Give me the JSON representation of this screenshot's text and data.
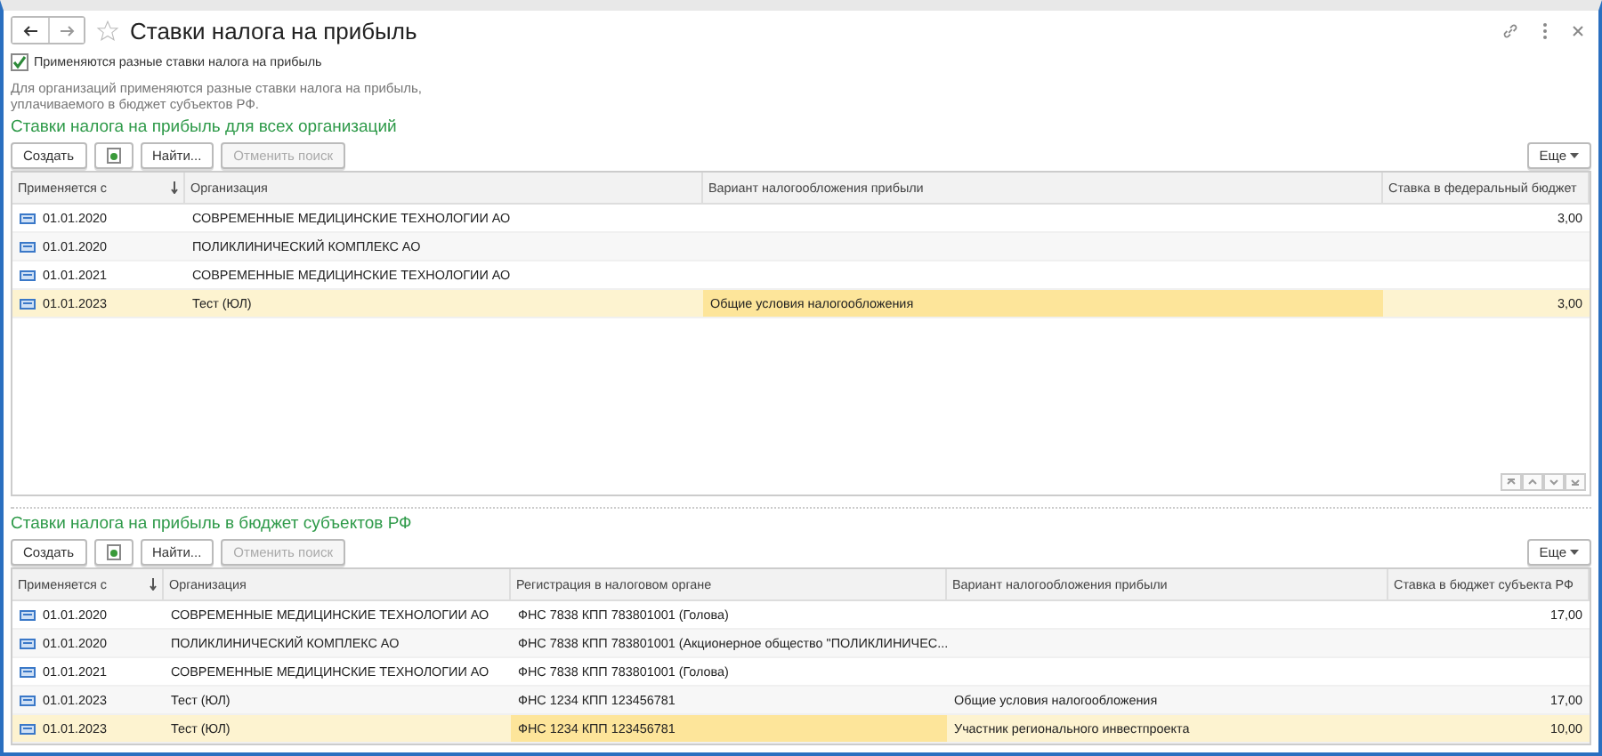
{
  "window": {
    "title": "Ставки налога на прибыль"
  },
  "option": {
    "label": "Применяются разные ставки налога на прибыль",
    "checked": true
  },
  "note": "Для организаций применяются разные ставки налога на прибыль,\nуплачиваемого в бюджет субъектов РФ.",
  "sections": [
    {
      "title": "Ставки налога на прибыль для всех организаций",
      "toolbar": {
        "create": "Создать",
        "find": "Найти...",
        "cancel": {
          "label": "Отменить поиск",
          "disabled": true
        },
        "more": "Еще"
      },
      "columns": [
        {
          "label": "Применяется с",
          "sorted": true,
          "current": false
        },
        {
          "label": "Организация",
          "sorted": false,
          "current": false
        },
        {
          "label": "Вариант налогообложения прибыли",
          "sorted": false,
          "current": true
        },
        {
          "label": "Ставка в федеральный бюджет",
          "sorted": false,
          "current": false
        }
      ],
      "rows": [
        {
          "cells": [
            "01.01.2020",
            "СОВРЕМЕННЫЕ МЕДИЦИНСКИЕ ТЕХНОЛОГИИ АО",
            "",
            "3,00"
          ],
          "selected": false
        },
        {
          "cells": [
            "01.01.2020",
            "ПОЛИКЛИНИЧЕСКИЙ КОМПЛЕКС АО",
            "",
            ""
          ],
          "selected": false
        },
        {
          "cells": [
            "01.01.2021",
            "СОВРЕМЕННЫЕ МЕДИЦИНСКИЕ ТЕХНОЛОГИИ АО",
            "",
            ""
          ],
          "selected": false
        },
        {
          "cells": [
            "01.01.2023",
            "Тест (ЮЛ)",
            "Общие условия налогообложения",
            "3,00"
          ],
          "selected": true
        }
      ],
      "pager": true
    },
    {
      "title": "Ставки налога на прибыль в бюджет субъектов РФ",
      "toolbar": {
        "create": "Создать",
        "find": "Найти...",
        "cancel": {
          "label": "Отменить поиск",
          "disabled": true
        },
        "more": "Еще"
      },
      "columns": [
        {
          "label": "Применяется с",
          "sorted": true,
          "current": false
        },
        {
          "label": "Организация",
          "sorted": false,
          "current": false
        },
        {
          "label": "Регистрация в налоговом органе",
          "sorted": false,
          "current": true
        },
        {
          "label": "Вариант налогообложения прибыли",
          "sorted": false,
          "current": false
        },
        {
          "label": "Ставка в бюджет субъекта РФ",
          "sorted": false,
          "current": false
        }
      ],
      "rows": [
        {
          "cells": [
            "01.01.2020",
            "СОВРЕМЕННЫЕ МЕДИЦИНСКИЕ ТЕХНОЛОГИИ АО",
            "ФНС 7838 КПП 783801001 (Голова)",
            "",
            "17,00"
          ],
          "selected": false
        },
        {
          "cells": [
            "01.01.2020",
            "ПОЛИКЛИНИЧЕСКИЙ КОМПЛЕКС АО",
            "ФНС 7838 КПП 783801001 (Акционерное общество \"ПОЛИКЛИНИЧЕС...",
            "",
            ""
          ],
          "selected": false
        },
        {
          "cells": [
            "01.01.2021",
            "СОВРЕМЕННЫЕ МЕДИЦИНСКИЕ ТЕХНОЛОГИИ АО",
            "ФНС 7838 КПП 783801001 (Голова)",
            "",
            ""
          ],
          "selected": false
        },
        {
          "cells": [
            "01.01.2023",
            "Тест (ЮЛ)",
            "ФНС 1234 КПП 123456781",
            "Общие условия налогообложения",
            "17,00"
          ],
          "selected": false
        },
        {
          "cells": [
            "01.01.2023",
            "Тест (ЮЛ)",
            "ФНС 1234 КПП 123456781",
            "Участник регионального инвестпроекта",
            "10,00"
          ],
          "selected": true
        }
      ],
      "pager": false
    }
  ]
}
